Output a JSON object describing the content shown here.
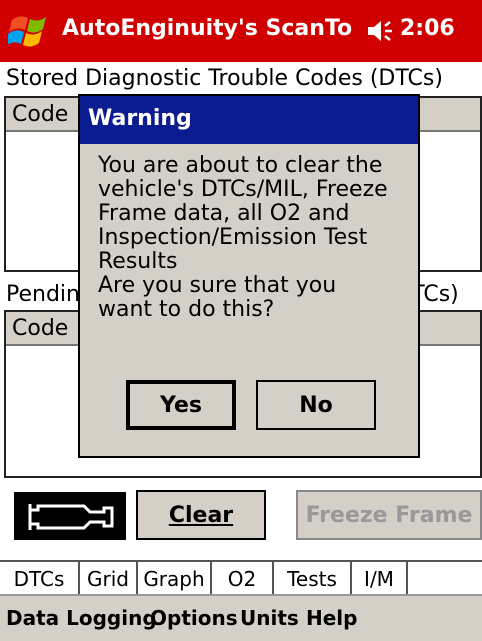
{
  "status_bar": {
    "title": "AutoEnginuity's ScanTo",
    "time": "2:06"
  },
  "stored_section": {
    "label": "Stored Diagnostic Trouble Codes (DTCs)",
    "column_header": "Code"
  },
  "pending_section": {
    "label": "Pending Diagnostic Trouble Codes (DTCs)",
    "column_header": "Code"
  },
  "toolbar": {
    "clear_label": "Clear",
    "freeze_frame_label": "Freeze Frame"
  },
  "tabs": [
    {
      "label": "DTCs",
      "active": true
    },
    {
      "label": "Grid",
      "active": false
    },
    {
      "label": "Graph",
      "active": false
    },
    {
      "label": "O2",
      "active": false
    },
    {
      "label": "Tests",
      "active": false
    },
    {
      "label": "I/M",
      "active": false
    }
  ],
  "menu": [
    {
      "label": "Data Logging"
    },
    {
      "label": "Options"
    },
    {
      "label": "Units"
    },
    {
      "label": "Help"
    }
  ],
  "dialog": {
    "title": "Warning",
    "message": "You are about to clear the\nvehicle's DTCs/MIL, Freeze\nFrame data,  all O2 and\nInspection/Emission Test\nResults\nAre you sure that you\nwant to do this?",
    "yes_label": "Yes",
    "no_label": "No"
  },
  "colors": {
    "titlebar_bg": "#d10000",
    "dialog_title_bg": "#0a1c8f",
    "control_face": "#d4d0c8"
  },
  "icons": [
    "windows-flag-icon",
    "speaker-icon",
    "check-engine-icon"
  ]
}
